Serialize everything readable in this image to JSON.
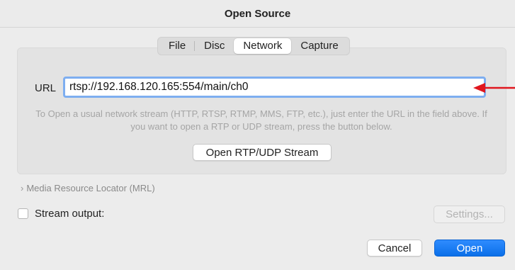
{
  "window": {
    "title": "Open Source"
  },
  "tabs": [
    {
      "label": "File"
    },
    {
      "label": "Disc"
    },
    {
      "label": "Network"
    },
    {
      "label": "Capture"
    }
  ],
  "network": {
    "url_label": "URL",
    "url_value": "rtsp://192.168.120.165:554/main/ch0",
    "help_text": "To Open a usual network stream (HTTP, RTSP, RTMP, MMS, FTP, etc.), just enter the URL in the field above. If you want to open a RTP or UDP stream, press the button below.",
    "rtp_button": "Open RTP/UDP Stream"
  },
  "mrl": {
    "label": "Media Resource Locator (MRL)"
  },
  "stream_output": {
    "label": "Stream output:",
    "checked": false,
    "settings_button": "Settings..."
  },
  "footer": {
    "cancel": "Cancel",
    "open": "Open"
  },
  "annotation": {
    "arrow_color": "#e0161e"
  },
  "colors": {
    "accent": "#0a6fe8",
    "focus_ring": "#7eaef0"
  }
}
